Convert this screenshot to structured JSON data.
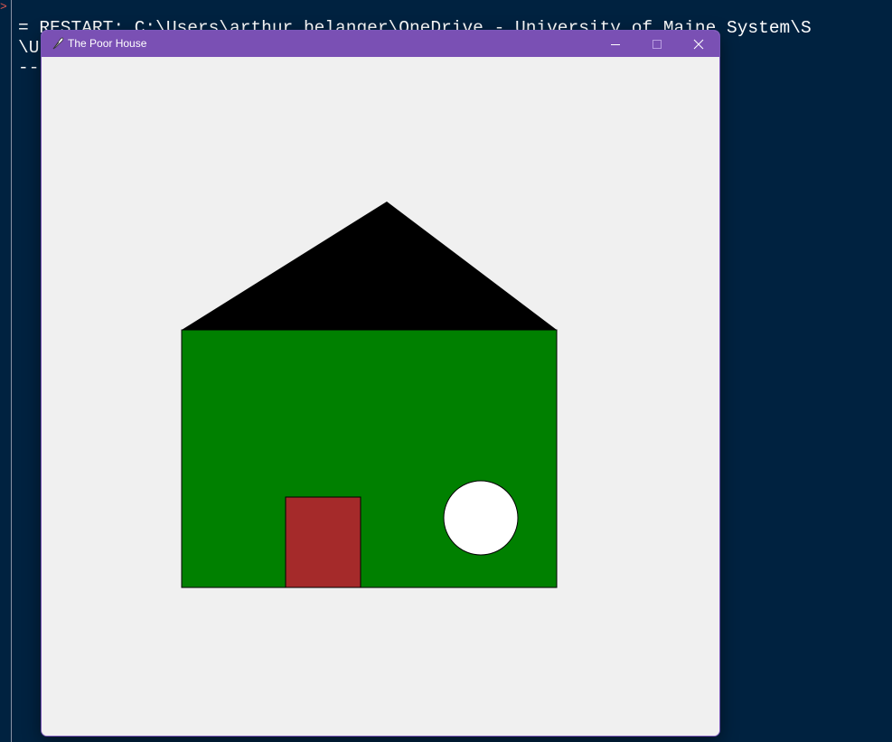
{
  "shell": {
    "prompt_mark": ">",
    "lines": [
      "= RESTART: C:\\Users\\arthur.belanger\\OneDrive - University of Maine System\\S",
      "\\U",
      "--"
    ]
  },
  "window": {
    "title": "The Poor House",
    "icons": {
      "app": "feather-icon",
      "minimize": "minimize-icon",
      "maximize": "maximize-icon",
      "close": "close-icon"
    }
  },
  "colors": {
    "shell_bg": "#002240",
    "titlebar": "#7a50b4",
    "canvas_bg": "#f0f0f0",
    "roof": "#000000",
    "wall": "#008000",
    "door": "#a52a2a",
    "window_circle": "#ffffff"
  }
}
